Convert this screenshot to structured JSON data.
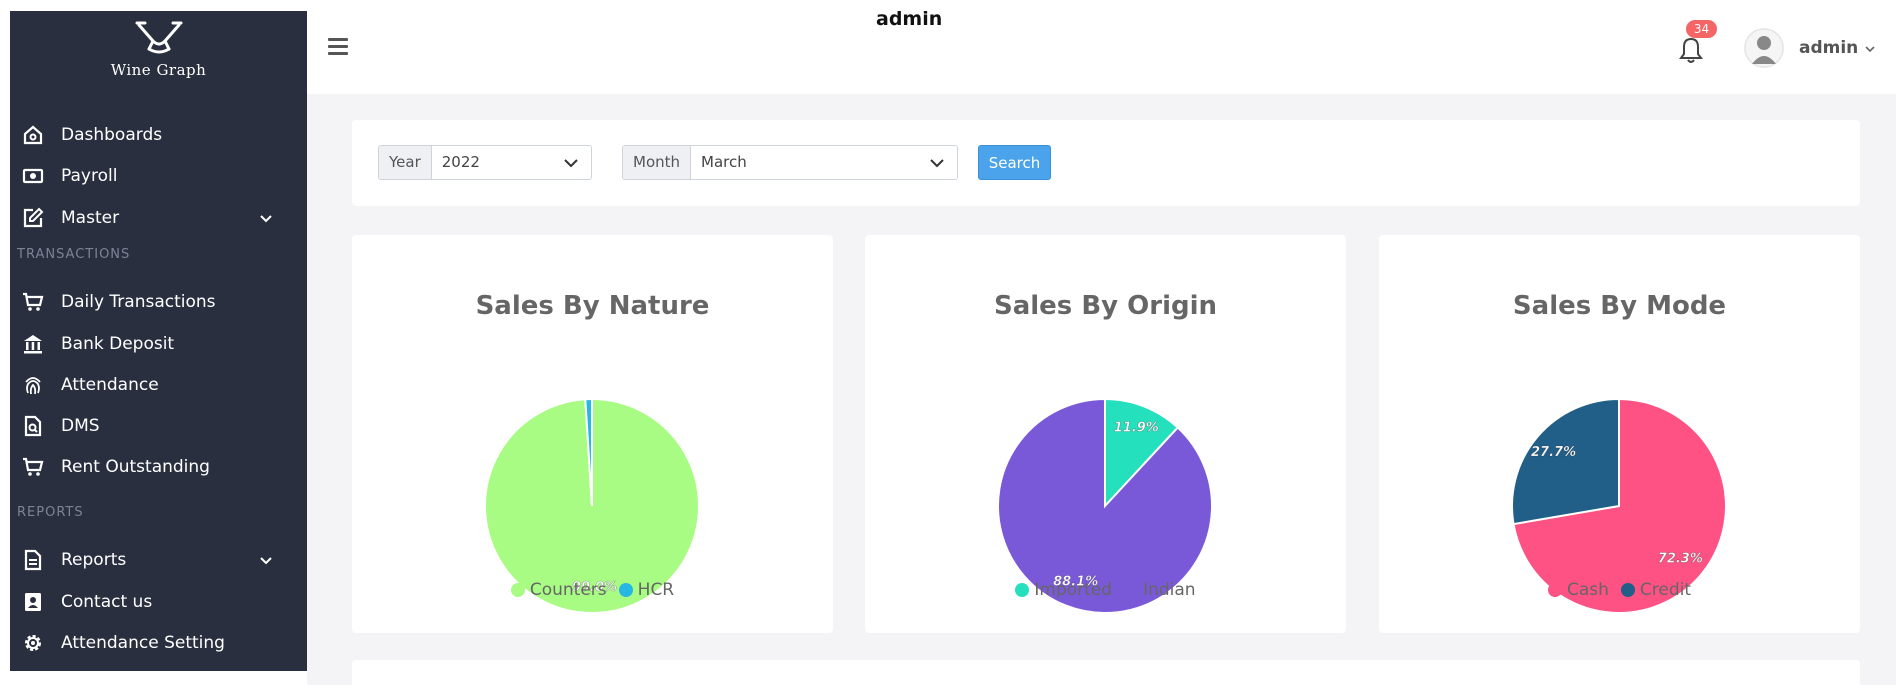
{
  "app": {
    "logo_text": "Wine Graph"
  },
  "sidebar": {
    "items": [
      {
        "label": "Dashboards"
      },
      {
        "label": "Payroll"
      },
      {
        "label": "Master"
      },
      {
        "label": "Daily Transactions"
      },
      {
        "label": "Bank Deposit"
      },
      {
        "label": "Attendance"
      },
      {
        "label": "DMS"
      },
      {
        "label": "Rent Outstanding"
      },
      {
        "label": "Reports"
      },
      {
        "label": "Contact us"
      },
      {
        "label": "Attendance Setting"
      }
    ],
    "sections": {
      "transactions": "TRANSACTIONS",
      "reports": "REPORTS"
    }
  },
  "header": {
    "title": "admin",
    "notification_count": "34",
    "user_name": "admin"
  },
  "filters": {
    "year_label": "Year",
    "year_value": "2022",
    "month_label": "Month",
    "month_value": "March",
    "search_label": "Search"
  },
  "colors": {
    "sidebar_bg": "#2a2f40",
    "accent": "#4ba3ec",
    "badge": "#f56565"
  },
  "chart_data": [
    {
      "type": "pie",
      "title": "Sales By Nature",
      "labels": [
        "Counters",
        "HCR"
      ],
      "values": [
        99.0,
        1.0
      ],
      "value_labels": [
        "99.0%",
        ""
      ],
      "colors": [
        "#a8fc83",
        "#27b7e4"
      ]
    },
    {
      "type": "pie",
      "title": "Sales By Origin",
      "labels": [
        "Imported",
        "Indian"
      ],
      "values": [
        11.9,
        88.1
      ],
      "value_labels": [
        "11.9%",
        "88.1%"
      ],
      "colors": [
        "#24e0bd",
        "#7a59d9"
      ]
    },
    {
      "type": "pie",
      "title": "Sales By Mode",
      "labels": [
        "Cash",
        "Credit"
      ],
      "values": [
        72.3,
        27.7
      ],
      "value_labels": [
        "72.3%",
        "27.7%"
      ],
      "colors": [
        "#fe5184",
        "#215e88"
      ]
    }
  ]
}
